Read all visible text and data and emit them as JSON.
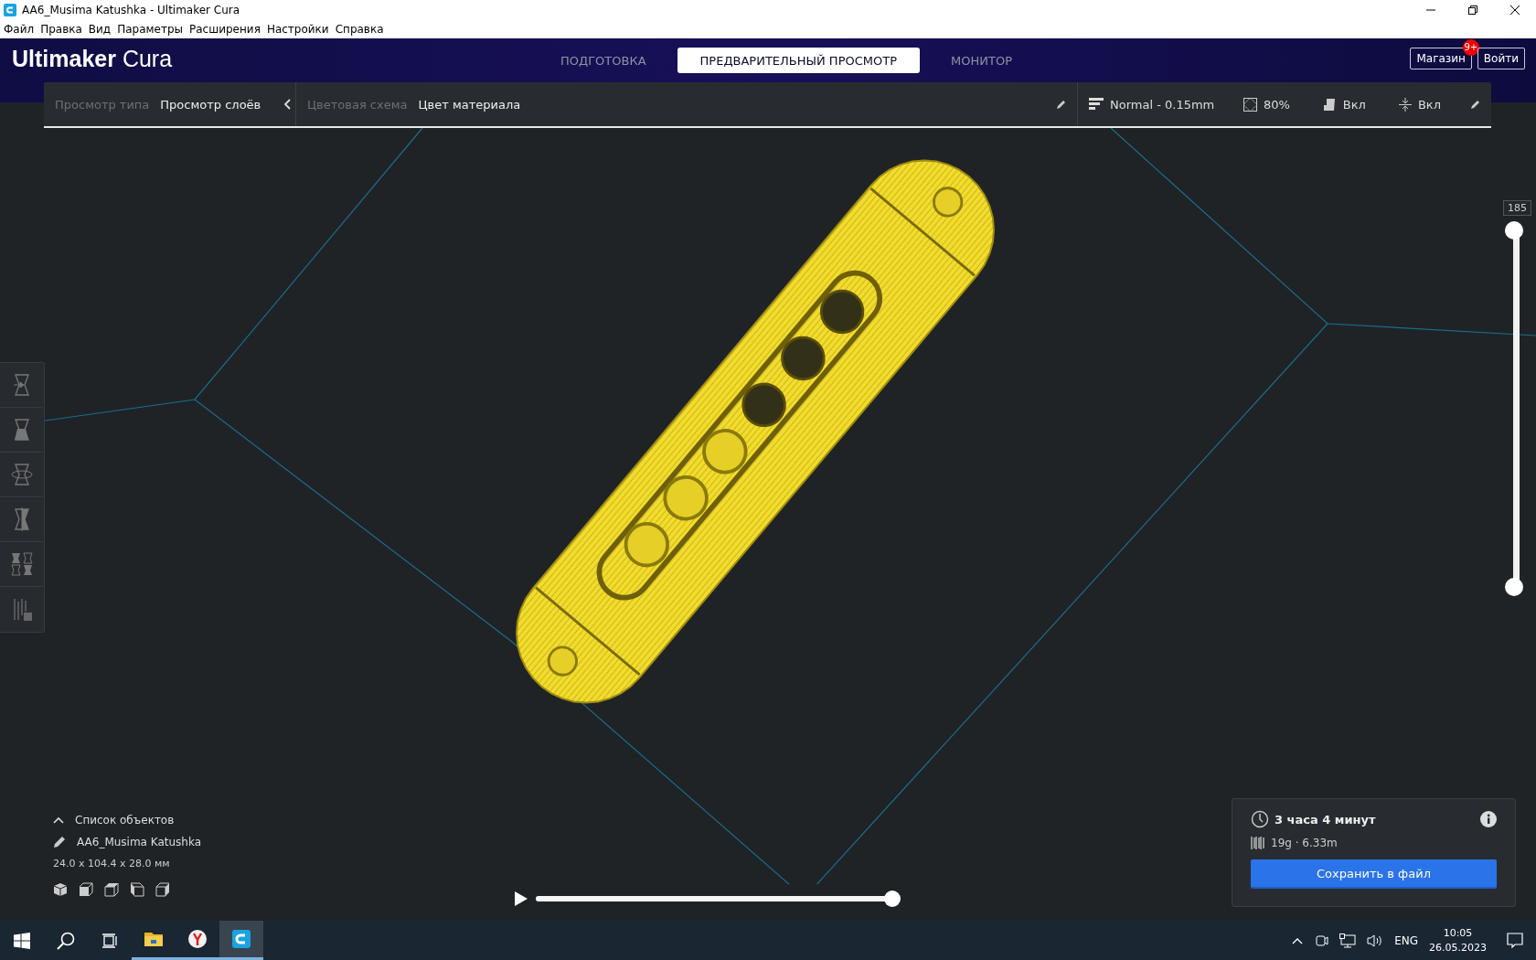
{
  "window": {
    "title": "AA6_Musima Katushka - Ultimaker Cura"
  },
  "menu": [
    "Файл",
    "Правка",
    "Вид",
    "Параметры",
    "Расширения",
    "Настройки",
    "Справка"
  ],
  "header": {
    "logo_bold": "Ultimaker",
    "logo_light": "Cura",
    "tabs": [
      {
        "label": "ПОДГОТОВКА",
        "selected": false
      },
      {
        "label": "ПРЕДВАРИТЕЛЬНЫЙ ПРОСМОТР",
        "selected": true
      },
      {
        "label": "МОНИТОР",
        "selected": false
      }
    ],
    "marketplace": {
      "label": "Магазин",
      "badge": "9+"
    },
    "login": "Войти"
  },
  "view_bar": {
    "view_type_label": "Просмотр типа",
    "view_type": "Просмотр слоёв",
    "color_scheme_label": "Цветовая схема",
    "color_scheme": "Цвет материала"
  },
  "print_settings": {
    "profile": "Normal - 0.15mm",
    "infill": "80%",
    "support": "Вкл",
    "adhesion": "Вкл"
  },
  "tools": [
    {
      "kind": "move",
      "selected": false
    },
    {
      "kind": "scale",
      "selected": false
    },
    {
      "kind": "rotate",
      "selected": false
    },
    {
      "kind": "mirror",
      "selected": false
    },
    {
      "kind": "per-model",
      "selected": false
    },
    {
      "kind": "support-blocker",
      "selected": false
    }
  ],
  "layer_slider": {
    "reading": "185",
    "upper": {
      "level": 1
    },
    "lower": {
      "level": 0
    }
  },
  "object_list": {
    "title": "Список объектов",
    "expanded": true,
    "object": "AA6_Musima Katushka",
    "dimensions": "24.0 x 104.4 x 28.0 мм",
    "view_buttons": [
      {
        "kind": "iso"
      },
      {
        "kind": "front"
      },
      {
        "kind": "top"
      },
      {
        "kind": "left"
      },
      {
        "kind": "right"
      }
    ]
  },
  "playback": {
    "playing": false,
    "level": 1
  },
  "print_info": {
    "time": "3 часа 4 минут",
    "material": "19g · 6.33m",
    "button": "Сохранить в файл"
  },
  "taskbar": {
    "apps": [
      {
        "kind": "folder",
        "selected": false
      },
      {
        "kind": "browser",
        "selected": false
      },
      {
        "kind": "cura",
        "selected": true
      }
    ],
    "language": "ENG",
    "time": "10:05",
    "date": "26.05.2023"
  }
}
